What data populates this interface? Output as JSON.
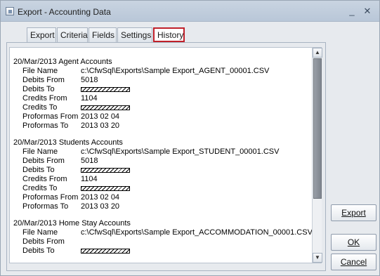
{
  "window": {
    "title": "Export - Accounting Data"
  },
  "tabs": [
    "Export",
    "Criteria",
    "Fields",
    "Settings",
    "History"
  ],
  "history": [
    {
      "header": "20/Mar/2013  Agent Accounts",
      "rows": [
        {
          "label": "File Name",
          "value": "c:\\CfwSql\\Exports\\Sample Export_AGENT_00001.CSV"
        },
        {
          "label": "Debits From",
          "value": "5018"
        },
        {
          "label": "Debits To",
          "value": "",
          "hatched": true
        },
        {
          "label": "Credits From",
          "value": "1104"
        },
        {
          "label": "Credits To",
          "value": "",
          "hatched": true
        },
        {
          "label": "Proformas From",
          "value": "2013 02 04"
        },
        {
          "label": "Proformas To",
          "value": "2013 03 20"
        }
      ]
    },
    {
      "header": "20/Mar/2013  Students Accounts",
      "rows": [
        {
          "label": "File Name",
          "value": "c:\\CfwSql\\Exports\\Sample Export_STUDENT_00001.CSV"
        },
        {
          "label": "Debits From",
          "value": "5018"
        },
        {
          "label": "Debits To",
          "value": "",
          "hatched": true
        },
        {
          "label": "Credits From",
          "value": "1104"
        },
        {
          "label": "Credits To",
          "value": "",
          "hatched": true
        },
        {
          "label": "Proformas From",
          "value": "2013 02 04"
        },
        {
          "label": "Proformas To",
          "value": "2013 03 20"
        }
      ]
    },
    {
      "header": "20/Mar/2013  Home Stay Accounts",
      "rows": [
        {
          "label": "File Name",
          "value": "c:\\CfwSql\\Exports\\Sample Export_ACCOMMODATION_00001.CSV"
        },
        {
          "label": "Debits From",
          "value": ""
        },
        {
          "label": "Debits To",
          "value": "",
          "hatched": true
        }
      ]
    }
  ],
  "buttons": {
    "export": "Export",
    "ok": "OK",
    "cancel": "Cancel"
  },
  "colors": {
    "active_tab_border": "#c0202a",
    "window_bg": "#e7eaee"
  }
}
